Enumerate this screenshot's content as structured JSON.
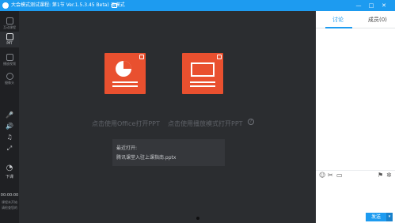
{
  "titlebar": {
    "title": "大会模式测试课程: 第1节 Ver.1.5.3.45 Beta) 云模式",
    "controls": [
      "—",
      "□",
      "✕"
    ]
  },
  "leftbar": {
    "items": [
      {
        "label": "互动课程"
      },
      {
        "label": "PPT"
      },
      {
        "label": "播放视频"
      },
      {
        "label": "摄像头"
      }
    ],
    "controls": [
      "🎤",
      "🔊",
      "♫",
      "⤢"
    ],
    "finish_label": "下课",
    "timer": "00:00:00",
    "status_line1": "课程未开始",
    "status_line2": "请检查您的"
  },
  "main": {
    "card_office_label": "点击使用Office打开PPT",
    "card_builtin_label": "点击使用播放模式打开PPT",
    "help_glyph": "?",
    "recent": {
      "header": "最近打开:",
      "file": "腾讯课堂入驻上课指南.pptx"
    }
  },
  "right": {
    "tab_discuss": "讨论",
    "tab_members": "成员(0)",
    "toolbar_icons": [
      "emoji-icon",
      "scissors-icon",
      "image-icon",
      "flag-icon",
      "gear-icon"
    ],
    "send_label": "发送"
  },
  "colors": {
    "accent": "#1d9bf0",
    "card": "#e9502f",
    "background": "#2b2d30"
  }
}
